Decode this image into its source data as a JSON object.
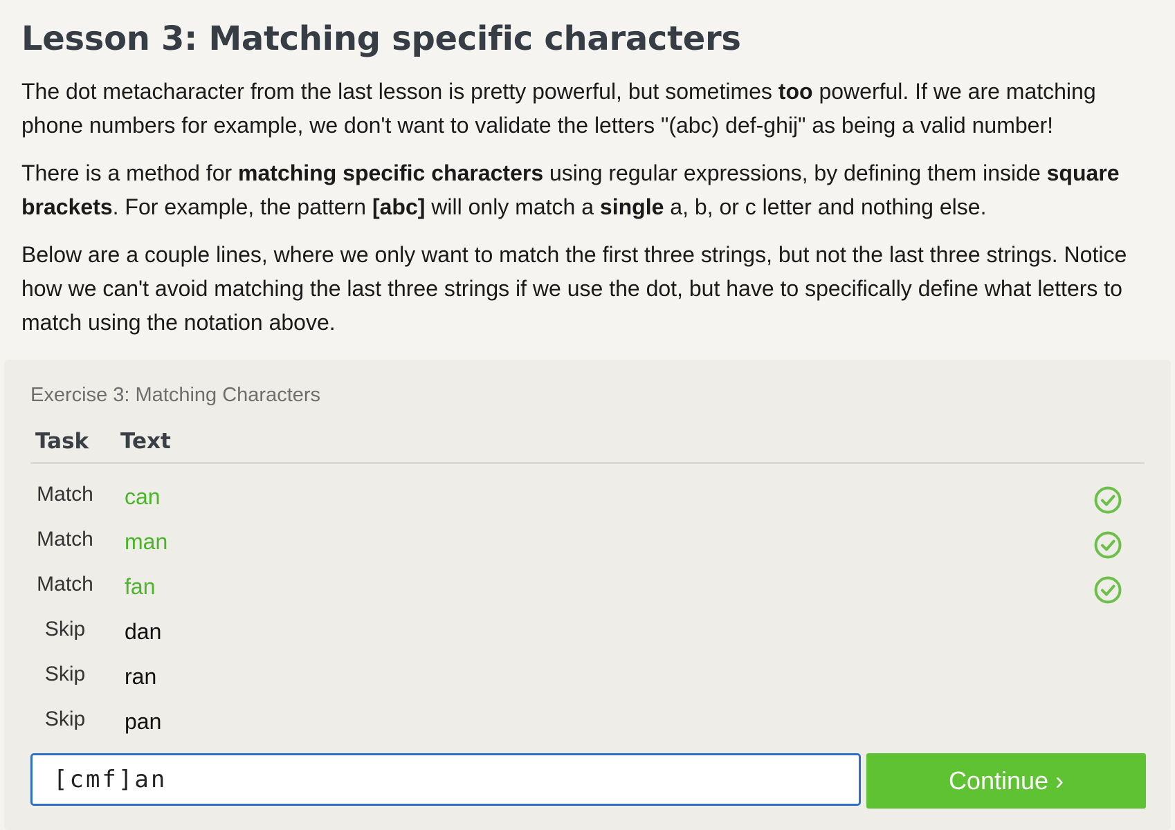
{
  "lesson": {
    "title": "Lesson 3: Matching specific characters",
    "p1": {
      "a": "The dot metacharacter from the last lesson is pretty powerful, but sometimes ",
      "b": "too",
      "c": " powerful. If we are matching phone numbers for example, we don't want to validate the letters \"(abc) def-ghij\" as being a valid number!"
    },
    "p2": {
      "a": "There is a method for ",
      "b": "matching specific characters",
      "c": " using regular expressions, by defining them inside ",
      "d": "square brackets",
      "e": ". For example, the pattern ",
      "f": "[abc]",
      "g": " will only match a ",
      "h": "single",
      "i": " a, b, or c letter and nothing else."
    },
    "p3": "Below are a couple lines, where we only want to match the first three strings, but not the last three strings. Notice how we can't avoid matching the last three strings if we use the dot, but have to specifically define what letters to match using the notation above."
  },
  "exercise": {
    "title": "Exercise 3: Matching Characters",
    "columns": {
      "task": "Task",
      "text": "Text"
    },
    "rows": [
      {
        "task": "Match",
        "text": "can",
        "status": "matched"
      },
      {
        "task": "Match",
        "text": "man",
        "status": "matched"
      },
      {
        "task": "Match",
        "text": "fan",
        "status": "matched"
      },
      {
        "task": "Skip",
        "text": "dan",
        "status": "none"
      },
      {
        "task": "Skip",
        "text": "ran",
        "status": "none"
      },
      {
        "task": "Skip",
        "text": "pan",
        "status": "none"
      }
    ],
    "input_value": "[cmf]an",
    "continue_label": "Continue ›"
  },
  "colors": {
    "match_green": "#4bb52a",
    "button_green": "#5ec232",
    "input_border": "#2d6fc7"
  },
  "icons": {
    "row_status": "check-circle-icon"
  }
}
